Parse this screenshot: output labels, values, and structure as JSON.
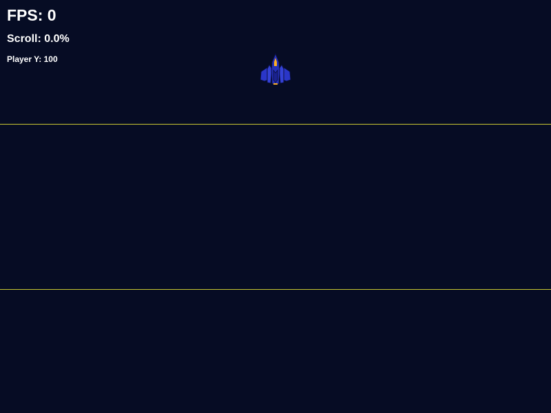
{
  "hud": {
    "fps": "FPS: 0",
    "scroll": "Scroll: 0.0%",
    "player_y": "Player Y: 100"
  },
  "game": {
    "player_sprite": "player-ship",
    "scroll_boundary_count": 2
  },
  "colors": {
    "background": "#060c24",
    "hud_text": "#ffffff",
    "boundary_line": "#c8c832",
    "ship_hull": "#2a36c8",
    "ship_outline": "#0a0f3c",
    "ship_flame": "#ffb020"
  }
}
